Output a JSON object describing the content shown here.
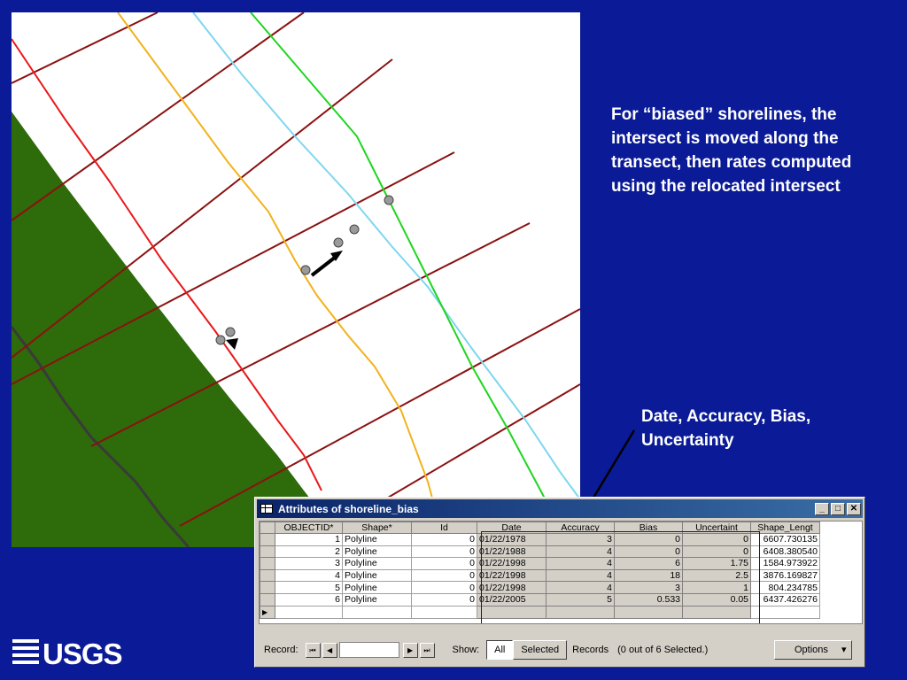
{
  "callouts": {
    "biased": "For “biased” shorelines, the intersect is moved along the transect, then rates computed using the relocated intersect",
    "fields": "Date, Accuracy, Bias, Uncertainty"
  },
  "map": {
    "colors": {
      "land": "#2e6b0a",
      "transect": "#8b1111",
      "shoreline_1978": "#e8191a",
      "shoreline_1988": "#f2b21d",
      "shoreline_1998": "#7fd6f0",
      "shoreline_2005": "#1fd61f",
      "boundary": "#3a3a3a",
      "arrow": "#000000",
      "intersect": "#9a9a9a"
    }
  },
  "window": {
    "title": "Attributes of shoreline_bias",
    "controls": {
      "minimize": "_",
      "maximize": "□",
      "close": "✕"
    }
  },
  "table": {
    "columns": [
      "OBJECTID*",
      "Shape*",
      "Id",
      "Date",
      "Accuracy",
      "Bias",
      "Uncertaint",
      "Shape_Lengt"
    ],
    "rows": [
      [
        "1",
        "Polyline",
        "0",
        "01/22/1978",
        "3",
        "0",
        "0",
        "6607.730135"
      ],
      [
        "2",
        "Polyline",
        "0",
        "01/22/1988",
        "4",
        "0",
        "0",
        "6408.380540"
      ],
      [
        "3",
        "Polyline",
        "0",
        "01/22/1998",
        "4",
        "6",
        "1.75",
        "1584.973922"
      ],
      [
        "4",
        "Polyline",
        "0",
        "01/22/1998",
        "4",
        "18",
        "2.5",
        "3876.169827"
      ],
      [
        "5",
        "Polyline",
        "0",
        "01/22/1998",
        "4",
        "3",
        "1",
        "804.234785"
      ],
      [
        "6",
        "Polyline",
        "0",
        "01/22/2005",
        "5",
        "0.533",
        "0.05",
        "6437.426276"
      ]
    ],
    "new_row_marker": "▶"
  },
  "statusbar": {
    "record_label": "Record:",
    "record_value": "",
    "nav": {
      "first": "⏮",
      "prev": "◀",
      "next": "▶",
      "last": "⏭"
    },
    "show_label": "Show:",
    "all_label": "All",
    "selected_label": "Selected",
    "records_label": "Records",
    "records_status": "(0 out of 6 Selected.)",
    "options_label": "Options",
    "options_arrow": "▾"
  },
  "logo": {
    "text": "USGS"
  }
}
